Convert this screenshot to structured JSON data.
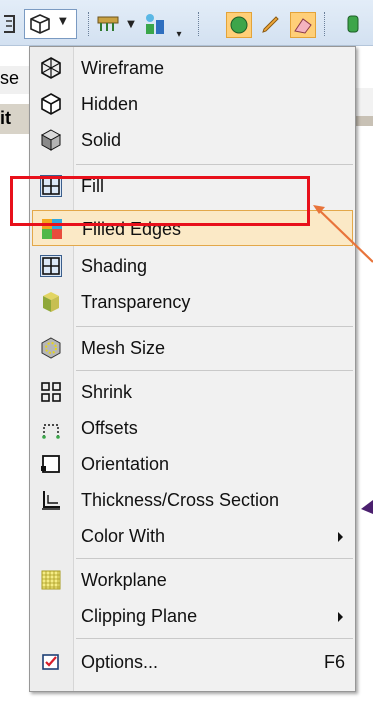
{
  "menu": {
    "items": [
      {
        "label": "Wireframe",
        "icon": "wireframe-cube-icon"
      },
      {
        "label": "Hidden",
        "icon": "hidden-cube-icon"
      },
      {
        "label": "Solid",
        "icon": "solid-cube-icon"
      },
      {
        "label": "Fill",
        "icon": "fill-grid-icon"
      },
      {
        "label": "Filled Edges",
        "icon": "filled-edges-icon"
      },
      {
        "label": "Shading",
        "icon": "shading-grid-icon"
      },
      {
        "label": "Transparency",
        "icon": "transparency-cube-icon"
      },
      {
        "label": "Mesh Size",
        "icon": "mesh-size-icon"
      },
      {
        "label": "Shrink",
        "icon": "shrink-icon"
      },
      {
        "label": "Offsets",
        "icon": "offsets-icon"
      },
      {
        "label": "Orientation",
        "icon": "orientation-icon"
      },
      {
        "label": "Thickness/Cross Section",
        "icon": "thickness-icon"
      },
      {
        "label": "Color With",
        "has_submenu": true
      },
      {
        "label": "Workplane",
        "icon": "workplane-icon"
      },
      {
        "label": "Clipping Plane",
        "has_submenu": true
      },
      {
        "label": "Options...",
        "icon": "options-check-icon",
        "shortcut": "F6"
      }
    ],
    "highlighted_item": "Filled Edges"
  },
  "background": {
    "fragment_1": "se",
    "fragment_2": "it"
  },
  "colors": {
    "highlight_fill": "#fbe9c6",
    "highlight_border": "#e3a84a",
    "annotation_red": "#e8101b",
    "annotation_orange": "#e8743b",
    "annotation_purple": "#4b1f6e"
  }
}
